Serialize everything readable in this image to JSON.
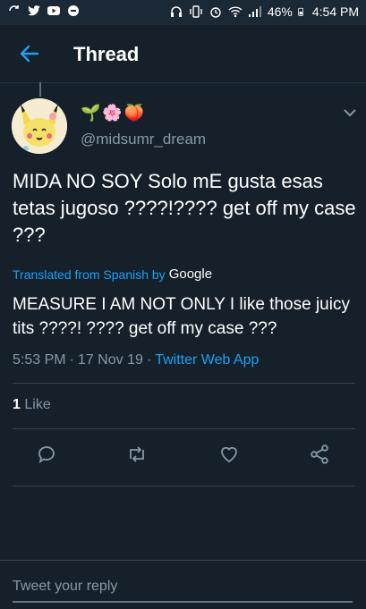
{
  "status_bar": {
    "battery": "46%",
    "time": "4:54 PM"
  },
  "header": {
    "title": "Thread"
  },
  "tweet": {
    "emojis": "🌱🌸🍑",
    "handle": "@midsumr_dream",
    "text": "MIDA NO SOY Solo mE gusta esas tetas jugoso ????!???? get off my case ???",
    "translated_label": "Translated from Spanish by",
    "translator": "Google",
    "translation": "MEASURE I AM NOT ONLY I like those juicy tits ????! ???? get off my case ???",
    "time": "5:53 PM",
    "sep1": "·",
    "date": "17 Nov 19",
    "sep2": "·",
    "app": "Twitter Web App",
    "likes_count": "1",
    "likes_label": "Like"
  },
  "reply": {
    "placeholder": "Tweet your reply"
  },
  "colors": {
    "background": "#15202b",
    "accent": "#1da1f2",
    "secondary_text": "#8899a6"
  }
}
